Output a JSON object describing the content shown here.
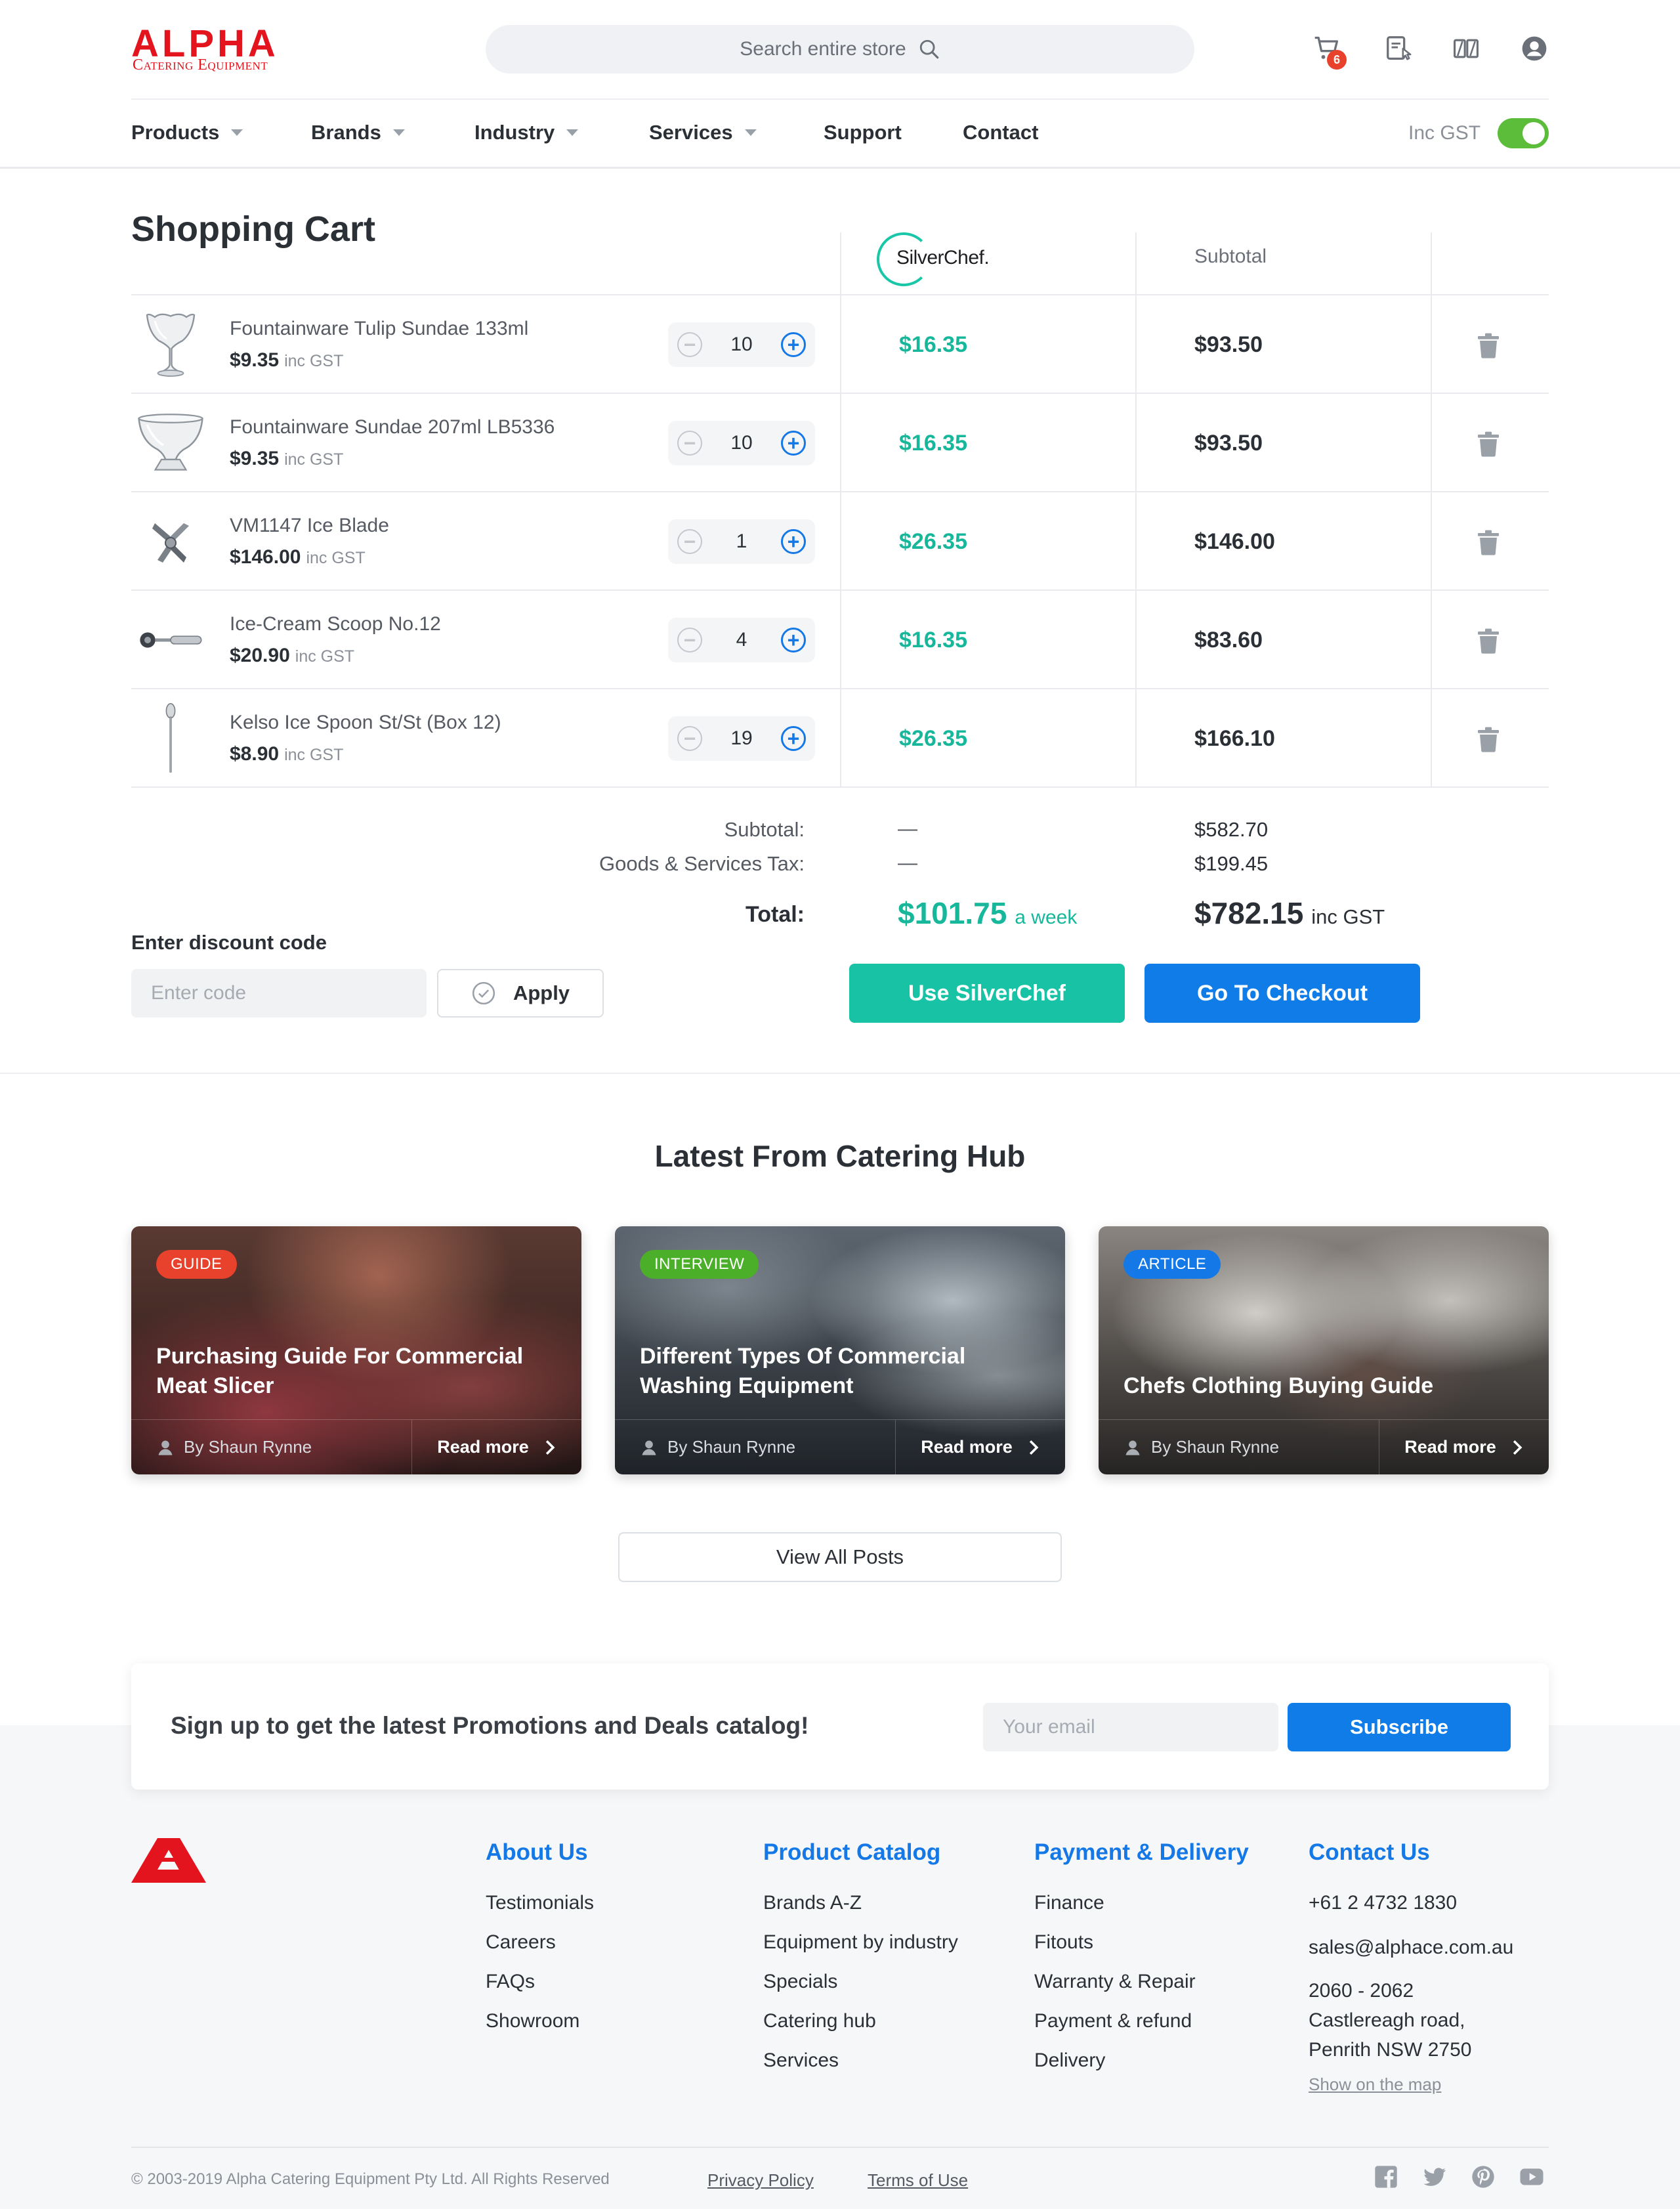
{
  "header": {
    "logo_word": "ALPHA",
    "logo_sub": "Catering Equipment",
    "search_placeholder": "Search entire store",
    "cart_count": "6",
    "icons": [
      "cart-icon",
      "quote-icon",
      "compare-icon",
      "account-icon"
    ]
  },
  "nav": {
    "items": [
      {
        "label": "Products",
        "dropdown": true
      },
      {
        "label": "Brands",
        "dropdown": true
      },
      {
        "label": "Industry",
        "dropdown": true
      },
      {
        "label": "Services",
        "dropdown": true
      },
      {
        "label": "Support",
        "dropdown": false
      },
      {
        "label": "Contact",
        "dropdown": false
      }
    ],
    "gst_label": "Inc GST",
    "gst_toggle_on": true
  },
  "cart": {
    "title": "Shopping Cart",
    "silverchef_logo": "SilverChef.",
    "subtotal_header": "Subtotal",
    "items": [
      {
        "name": "Fountainware Tulip Sundae 133ml",
        "price": "$9.35",
        "price_suffix": "inc GST",
        "qty": "10",
        "silverchef": "$16.35",
        "subtotal": "$93.50"
      },
      {
        "name": "Fountainware Sundae 207ml LB5336",
        "price": "$9.35",
        "price_suffix": "inc GST",
        "qty": "10",
        "silverchef": "$16.35",
        "subtotal": "$93.50"
      },
      {
        "name": "VM1147 Ice Blade",
        "price": "$146.00",
        "price_suffix": "inc GST",
        "qty": "1",
        "silverchef": "$26.35",
        "subtotal": "$146.00"
      },
      {
        "name": "Ice-Cream Scoop No.12",
        "price": "$20.90",
        "price_suffix": "inc GST",
        "qty": "4",
        "silverchef": "$16.35",
        "subtotal": "$83.60"
      },
      {
        "name": "Kelso Ice Spoon St/St (Box 12)",
        "price": "$8.90",
        "price_suffix": "inc GST",
        "qty": "19",
        "silverchef": "$26.35",
        "subtotal": "$166.10"
      }
    ],
    "totals": {
      "subtotal_label": "Subtotal:",
      "subtotal_sc": "—",
      "subtotal_value": "$582.70",
      "gst_label": "Goods & Services Tax:",
      "gst_sc": "—",
      "gst_value": "$199.45",
      "total_label": "Total:",
      "total_sc": "$101.75",
      "total_sc_suffix": "a week",
      "total_value": "$782.15",
      "total_suffix": "inc GST"
    },
    "discount_label": "Enter discount code",
    "discount_placeholder": "Enter code",
    "apply_label": "Apply",
    "silverchef_button": "Use SilverChef",
    "checkout_button": "Go To Checkout"
  },
  "hub": {
    "title": "Latest From Catering Hub",
    "cards": [
      {
        "tag": "GUIDE",
        "tag_color": "#e8412c",
        "title": "Purchasing Guide For Commercial Meat Slicer",
        "author": "By Shaun Rynne",
        "read_more": "Read more"
      },
      {
        "tag": "INTERVIEW",
        "tag_color": "#4caf2a",
        "title": "Different Types Of Commercial Washing Equipment",
        "author": "By Shaun Rynne",
        "read_more": "Read more"
      },
      {
        "tag": "ARTICLE",
        "tag_color": "#1479e6",
        "title": "Chefs Clothing Buying Guide",
        "author": "By Shaun Rynne",
        "read_more": "Read more"
      }
    ],
    "view_all": "View All Posts"
  },
  "newsletter": {
    "text": "Sign up to get the latest Promotions and Deals catalog!",
    "email_placeholder": "Your email",
    "subscribe": "Subscribe"
  },
  "footer": {
    "columns": [
      {
        "heading": "About Us",
        "links": [
          "Testimonials",
          "Careers",
          "FAQs",
          "Showroom"
        ]
      },
      {
        "heading": "Product Catalog",
        "links": [
          "Brands A-Z",
          "Equipment by industry",
          "Specials",
          "Catering hub",
          "Services"
        ]
      },
      {
        "heading": "Payment & Delivery",
        "links": [
          "Finance",
          "Fitouts",
          "Warranty & Repair",
          "Payment & refund",
          "Delivery"
        ]
      }
    ],
    "contact": {
      "heading": "Contact Us",
      "phone": "+61 2 4732 1830",
      "email": "sales@alphace.com.au",
      "address_1": "2060 - 2062",
      "address_2": "Castlereagh road,",
      "address_3": "Penrith NSW 2750",
      "map_link": "Show on the map"
    },
    "copyright": "© 2003-2019 Alpha Catering Equipment Pty Ltd. All Rights Reserved",
    "privacy": "Privacy Policy",
    "terms": "Terms of Use",
    "social": [
      "facebook-icon",
      "twitter-icon",
      "pinterest-icon",
      "youtube-icon"
    ]
  },
  "colors": {
    "brand_red": "#e3141d",
    "accent_blue": "#0f7ce8",
    "silverchef_teal": "#18c2a5",
    "toggle_green": "#5bbd3a"
  }
}
